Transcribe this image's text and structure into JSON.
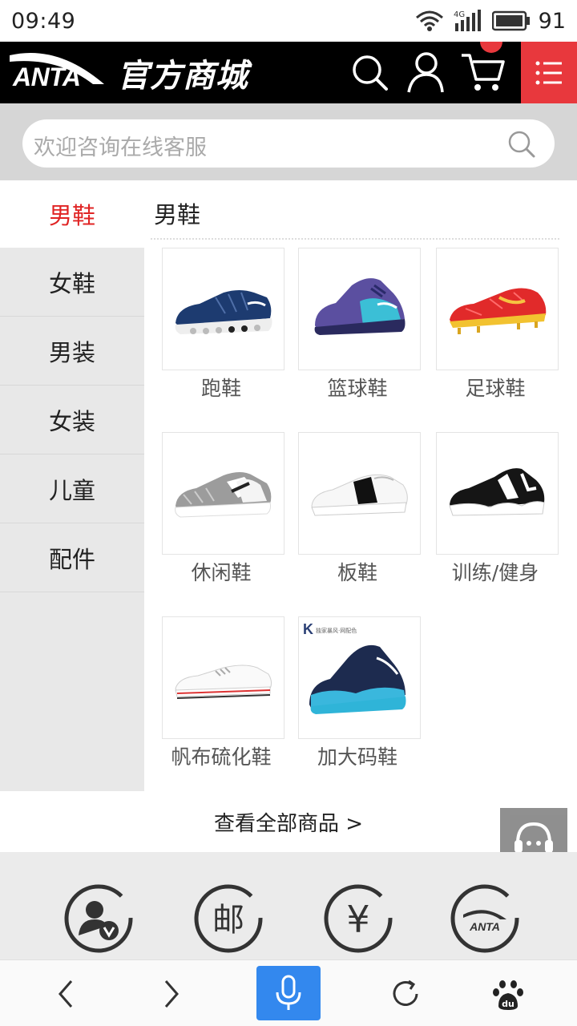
{
  "status_bar": {
    "time": "09:49",
    "network": "4G",
    "battery": "91"
  },
  "header": {
    "brand": "ANTA",
    "title": "官方商城",
    "icons": [
      "search-icon",
      "user-icon",
      "cart-icon",
      "menu-icon"
    ],
    "accent_color": "#e8383d"
  },
  "search": {
    "placeholder": "欢迎咨询在线客服"
  },
  "category": {
    "active": "男鞋",
    "heading": "男鞋",
    "active_color": "#e02424"
  },
  "sidebar": {
    "items": [
      {
        "label": "女鞋"
      },
      {
        "label": "男装"
      },
      {
        "label": "女装"
      },
      {
        "label": "儿童"
      },
      {
        "label": "配件"
      }
    ]
  },
  "products": [
    {
      "label": "跑鞋"
    },
    {
      "label": "篮球鞋"
    },
    {
      "label": "足球鞋"
    },
    {
      "label": "休闲鞋"
    },
    {
      "label": "板鞋"
    },
    {
      "label": "训练/健身"
    },
    {
      "label": "帆布硫化鞋"
    },
    {
      "label": "加大码鞋"
    }
  ],
  "product8_tag": {
    "letter": "K",
    "text": "独家暴风·网配色"
  },
  "view_all": "查看全部商品 >",
  "services": [
    {
      "icon": "member-v-icon"
    },
    {
      "icon": "mail-icon",
      "glyph": "邮"
    },
    {
      "icon": "yen-icon",
      "glyph": "¥"
    },
    {
      "icon": "anta-brand-icon",
      "glyph": "ANTA"
    }
  ],
  "browser_bar": {
    "buttons": [
      "back-icon",
      "forward-icon",
      "voice-icon",
      "refresh-icon",
      "baidu-icon"
    ],
    "baidu_glyph": "du",
    "voice_color": "#3388ee"
  }
}
